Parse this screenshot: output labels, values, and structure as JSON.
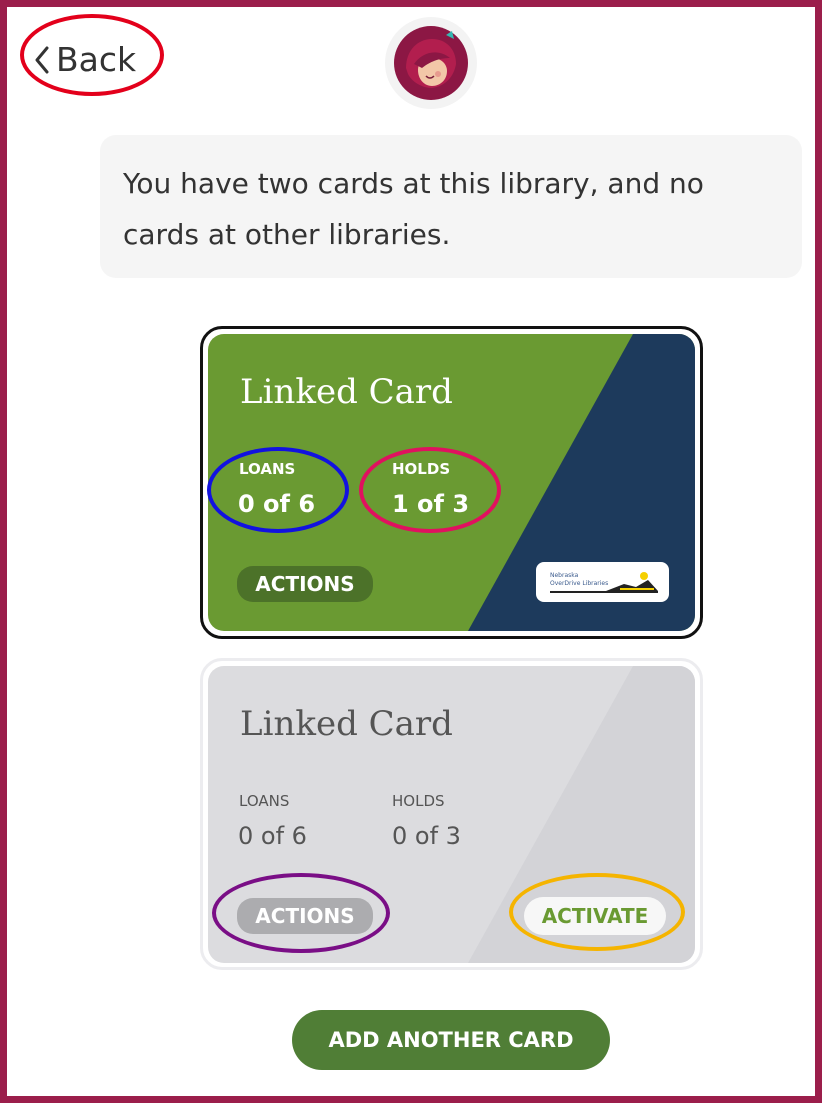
{
  "nav": {
    "back_label": "Back"
  },
  "message": {
    "text": "You have two cards at this library, and no cards at other libraries."
  },
  "cards": [
    {
      "title": "Linked Card",
      "loans_label": "LOANS",
      "loans_value": "0 of 6",
      "holds_label": "HOLDS",
      "holds_value": "1 of 3",
      "actions_label": "ACTIONS",
      "state": "active"
    },
    {
      "title": "Linked Card",
      "loans_label": "LOANS",
      "loans_value": "0 of 6",
      "holds_label": "HOLDS",
      "holds_value": "0 of 3",
      "actions_label": "ACTIONS",
      "activate_label": "ACTIVATE",
      "state": "inactive"
    }
  ],
  "footer": {
    "add_card_label": "ADD ANOTHER CARD"
  },
  "colors": {
    "frame": "#9b1e4b",
    "card_green": "#6a9a32",
    "card_navy": "#1d3a5c",
    "card_gray": "#dcdcdf",
    "button_green": "#507e36",
    "annotation_red": "#e3001b",
    "annotation_blue": "#1212e0",
    "annotation_pink": "#e0115f",
    "annotation_purple": "#7a0e86",
    "annotation_yellow": "#f5b400"
  }
}
